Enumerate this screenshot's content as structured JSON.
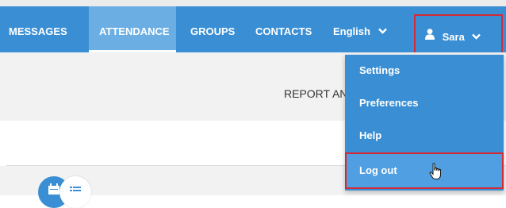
{
  "nav": {
    "items": [
      {
        "label": "MESSAGES"
      },
      {
        "label": "ATTENDANCE",
        "active": true
      },
      {
        "label": "GROUPS"
      },
      {
        "label": "CONTACTS"
      }
    ],
    "language": "English",
    "user": "Sara"
  },
  "page": {
    "report_text": "REPORT AN"
  },
  "user_menu": {
    "items": [
      {
        "label": "Settings"
      },
      {
        "label": "Preferences"
      },
      {
        "label": "Help"
      },
      {
        "label": "Log out",
        "hovered": true
      }
    ]
  },
  "icons": {
    "language_dropdown": "chevron-down-icon",
    "user": "user-icon",
    "user_dropdown": "chevron-down-icon",
    "calendar": "calendar-icon",
    "list": "list-icon",
    "cursor": "hand-pointer-icon"
  },
  "colors": {
    "nav_bg": "#3a8fd4",
    "nav_active_bg": "#6aaee4",
    "highlight_border": "#d42a35",
    "page_band": "#f2f2f2"
  }
}
